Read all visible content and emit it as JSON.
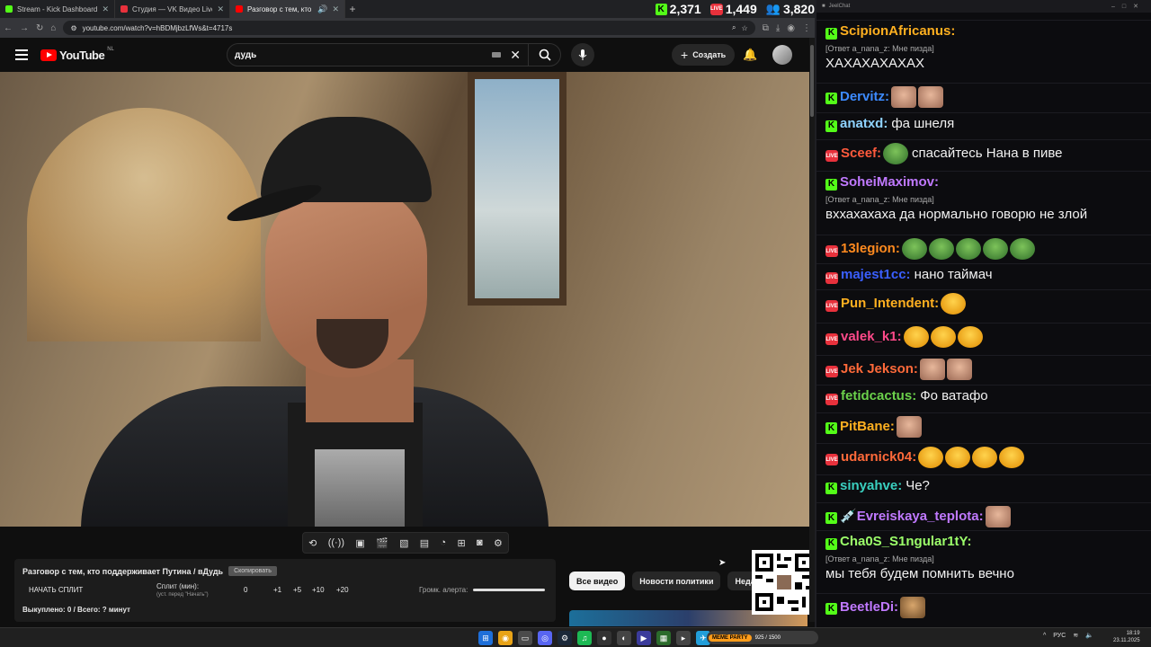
{
  "browser": {
    "tabs": [
      {
        "title": "Stream - Kick Dashboard",
        "color": "#53fc18"
      },
      {
        "title": "Студия — VK Видео Live",
        "color": "#e8313c"
      },
      {
        "title": "Разговор с тем, кто поддерживает",
        "color": "#ff0000",
        "active": true
      }
    ],
    "new_tab": "+",
    "url": "youtube.com/watch?v=hBDMjbzLfWs&t=4717s"
  },
  "viewers": {
    "kick": "2,371",
    "vk": "1,449",
    "total": "3,820",
    "vk_label": "LIVE"
  },
  "youtube": {
    "logo": "YouTube",
    "region": "NL",
    "search_value": "дудь",
    "create_label": "Создать"
  },
  "panel": {
    "title": "Разговор с тем, кто поддерживает Путина / вДудь",
    "badge": "Скопировать",
    "split_button": "НАЧАТЬ СПЛИТ",
    "split_label": "Сплит (мин):",
    "split_sub": "(уст. перед \"Начать\")",
    "split_value": "0",
    "increments": [
      "+1",
      "+5",
      "+10",
      "+20"
    ],
    "volume_label": "Громк. алерта:",
    "paid": "Выкуплено: 0 / Всего: ? минут"
  },
  "chips": [
    "Все видео",
    "Новости политики",
    "Недавно"
  ],
  "chat": {
    "window_title": "JeelChat",
    "messages": [
      {
        "platform": "kick",
        "user": "ScipionAfricanus:",
        "color": "#ffb020",
        "reply": "[Ответ a_nana_z: Мне пизда]",
        "text": "ХАХАХАХАХАХ"
      },
      {
        "platform": "kick",
        "user": "Dervitz:",
        "color": "#3d8bff",
        "emotes": [
          "face",
          "face"
        ]
      },
      {
        "platform": "kick",
        "user": "anatxd:",
        "color": "#8fd3ff",
        "text": "фа шнеля"
      },
      {
        "platform": "vk",
        "user": "Sceef:",
        "color": "#ff5a3c",
        "emotes": [
          "pepe"
        ],
        "text": "спасайтесь Нана в пиве"
      },
      {
        "platform": "kick",
        "user": "SoheiMaximov:",
        "color": "#c079ff",
        "reply": "[Ответ a_nana_z: Мне пизда]",
        "text": "вххахахаха да нормально говорю не злой"
      },
      {
        "platform": "vk",
        "user": "13legion:",
        "color": "#ff8a1f",
        "emotes": [
          "pepe",
          "pepe",
          "pepe",
          "pepe",
          "pepe"
        ]
      },
      {
        "platform": "vk",
        "user": "majest1cc:",
        "color": "#3a5fff",
        "text": "нано таймач"
      },
      {
        "platform": "vk",
        "user": "Pun_Intendent:",
        "color": "#ffb020",
        "emotes": [
          "laugh"
        ]
      },
      {
        "platform": "vk",
        "user": "valek_k1:",
        "color": "#ff4a8a",
        "emotes": [
          "laugh",
          "laugh",
          "laugh"
        ]
      },
      {
        "platform": "vk",
        "user": "Jek Jekson:",
        "color": "#ff6a3a",
        "emotes": [
          "face",
          "face"
        ]
      },
      {
        "platform": "vk",
        "user": "fetidcactus:",
        "color": "#6bd14b",
        "text": "Фо ватафо"
      },
      {
        "platform": "kick",
        "user": "PitBane:",
        "color": "#ffb020",
        "emotes": [
          "face"
        ]
      },
      {
        "platform": "vk",
        "user": "udarnick04:",
        "color": "#ff6a3a",
        "emotes": [
          "laugh",
          "laugh",
          "laugh",
          "laugh"
        ]
      },
      {
        "platform": "kick",
        "user": "sinyahve:",
        "color": "#3ad0c0",
        "text": "Че?"
      },
      {
        "platform": "kick",
        "user": "Evreiskaya_teplota:",
        "color": "#c079ff",
        "emotes": [
          "face"
        ],
        "prefix": "💉"
      },
      {
        "platform": "kick",
        "user": "Cha0S_S1ngular1tY:",
        "color": "#9cff6a",
        "reply": "[Ответ a_nana_z: Мне пизда]",
        "text": "мы тебя будем помнить вечно"
      },
      {
        "platform": "kick",
        "user": "BeetleDi:",
        "color": "#c079ff",
        "emotes": [
          "cat"
        ]
      }
    ]
  },
  "taskbar": {
    "meme_party": "MEME PARTY",
    "meme_count": "925 / 1500",
    "lang": "РУС",
    "time": "18:19",
    "date": "23.11.2025"
  }
}
